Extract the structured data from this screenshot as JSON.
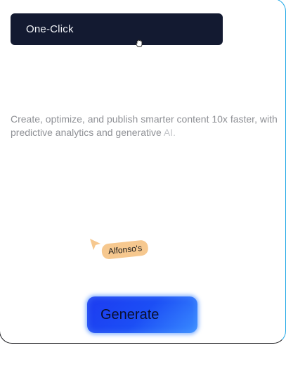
{
  "headline": {
    "label": "One-Click"
  },
  "description": {
    "text": "Create, optimize, and publish smarter content 10x faster, with predictive analytics and generative ",
    "faded_text": "AI."
  },
  "collaborator": {
    "name": "Alfonso's",
    "color": "#f6c88f"
  },
  "cta": {
    "label": "Generate",
    "color": "#1d3bf0"
  },
  "icons": {
    "cursor": "grab-hand-cursor-icon",
    "pointer": "collaborator-pointer-icon"
  }
}
